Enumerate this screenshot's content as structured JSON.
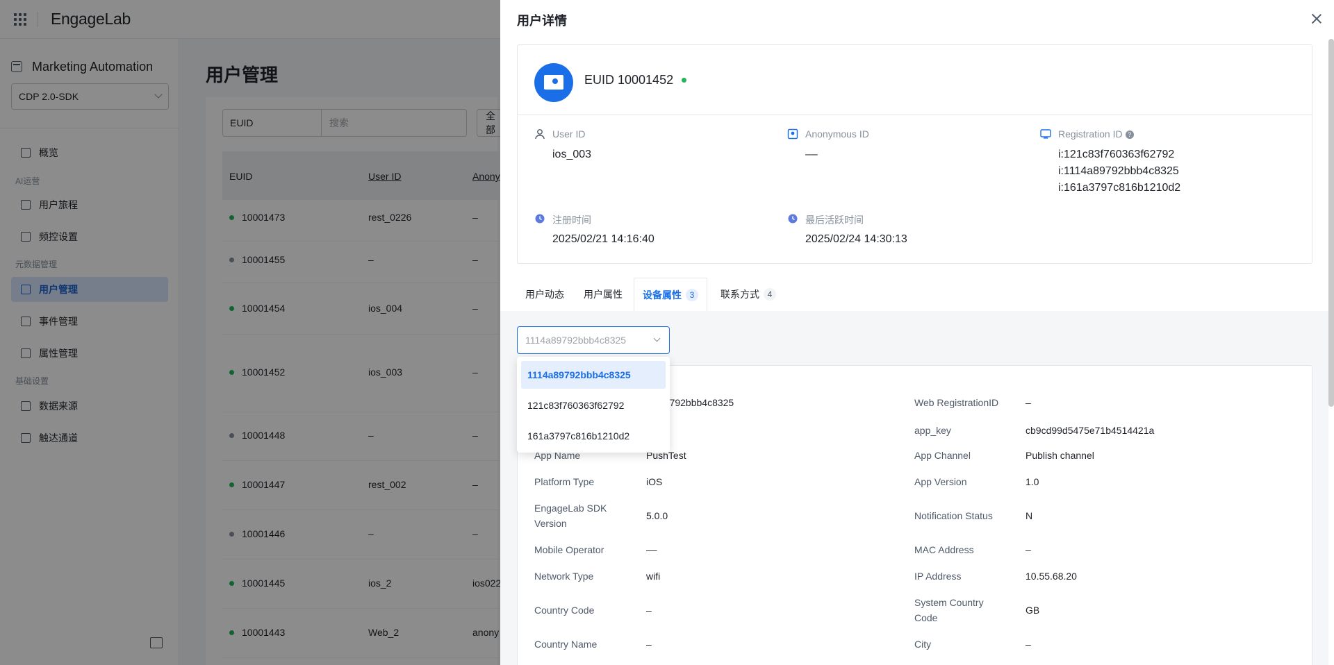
{
  "topbar": {
    "logo": "EngageLab"
  },
  "sidebar": {
    "app_title": "Marketing Automation",
    "project_select": "CDP 2.0-SDK",
    "items": [
      {
        "label": "概览",
        "name": "overview"
      },
      {
        "group": "AI运营"
      },
      {
        "label": "用户旅程",
        "name": "user-journey"
      },
      {
        "label": "频控设置",
        "name": "frequency-control"
      },
      {
        "group": "元数据管理"
      },
      {
        "label": "用户管理",
        "name": "user-management",
        "active": true
      },
      {
        "label": "事件管理",
        "name": "event-management"
      },
      {
        "label": "属性管理",
        "name": "attribute-management"
      },
      {
        "group": "基础设置"
      },
      {
        "label": "数据来源",
        "name": "data-source"
      },
      {
        "label": "触达通道",
        "name": "reach-channel"
      }
    ]
  },
  "main": {
    "title": "用户管理",
    "filter_field": "EUID",
    "search_placeholder": "搜索",
    "filter_all": "全部",
    "columns": [
      "EUID",
      "User ID",
      "Anony"
    ],
    "rows": [
      {
        "euid": "10001473",
        "user_id": "rest_0226",
        "anon": "–",
        "status": "green"
      },
      {
        "euid": "10001455",
        "user_id": "–",
        "anon": "–",
        "status": "gray"
      },
      {
        "euid": "10001454",
        "user_id": "ios_004",
        "anon": "–",
        "status": "green"
      },
      {
        "euid": "10001452",
        "user_id": "ios_003",
        "anon": "–",
        "status": "green"
      },
      {
        "euid": "10001448",
        "user_id": "–",
        "anon": "–",
        "status": "gray"
      },
      {
        "euid": "10001447",
        "user_id": "rest_002",
        "anon": "–",
        "status": "green"
      },
      {
        "euid": "10001446",
        "user_id": "–",
        "anon": "–",
        "status": "gray"
      },
      {
        "euid": "10001445",
        "user_id": "ios_2",
        "anon": "ios022",
        "status": "green"
      },
      {
        "euid": "10001443",
        "user_id": "Web_2",
        "anon": "anony",
        "status": "green"
      }
    ]
  },
  "drawer": {
    "title": "用户详情",
    "euid_label": "EUID 10001452",
    "fields": {
      "user_id_label": "User ID",
      "user_id": "ios_003",
      "anon_label": "Anonymous ID",
      "anon": "––",
      "reg_label": "Registration ID",
      "reg_ids": [
        "i:121c83f760363f62792",
        "i:1114a89792bbb4c8325",
        "i:161a3797c816b1210d2"
      ],
      "signup_label": "注册时间",
      "signup": "2025/02/21 14:16:40",
      "active_label": "最后活跃时间",
      "active": "2025/02/24 14:30:13"
    },
    "tabs": [
      {
        "label": "用户动态"
      },
      {
        "label": "用户属性"
      },
      {
        "label": "设备属性",
        "count": "3",
        "active": true
      },
      {
        "label": "联系方式",
        "count": "4"
      }
    ],
    "device_select": "1114a89792bbb4c8325",
    "device_options": [
      "1114a89792bbb4c8325",
      "121c83f760363f62792",
      "161a3797c816b1210d2"
    ],
    "device_attrs": {
      "reg_partial": "89792bbb4c8325",
      "web_reg_label": "Web RegistrationID",
      "web_reg": "–",
      "app_key_label": "app_key",
      "app_key": "cb9cd99d5475e71b4514421a",
      "app_name_label": "App Name",
      "app_name": "PushTest",
      "app_channel_label": "App Channel",
      "app_channel": "Publish channel",
      "platform_label": "Platform Type",
      "platform": "iOS",
      "app_version_label": "App Version",
      "app_version": "1.0",
      "sdk_label": "EngageLab SDK Version",
      "sdk": "5.0.0",
      "notif_label": "Notification Status",
      "notif": "N",
      "operator_label": "Mobile Operator",
      "operator": "––",
      "mac_label": "MAC Address",
      "mac": "–",
      "network_label": "Network Type",
      "network": "wifi",
      "ip_label": "IP Address",
      "ip": "10.55.68.20",
      "cc_label": "Country Code",
      "cc": "–",
      "scc_label": "System Country Code",
      "scc": "GB",
      "cname_label": "Country Name",
      "cname": "–",
      "city_label": "City",
      "city": "–"
    }
  },
  "colors": {
    "accent": "#1a6fe8",
    "online": "#23b55a",
    "offline": "#86909c"
  }
}
